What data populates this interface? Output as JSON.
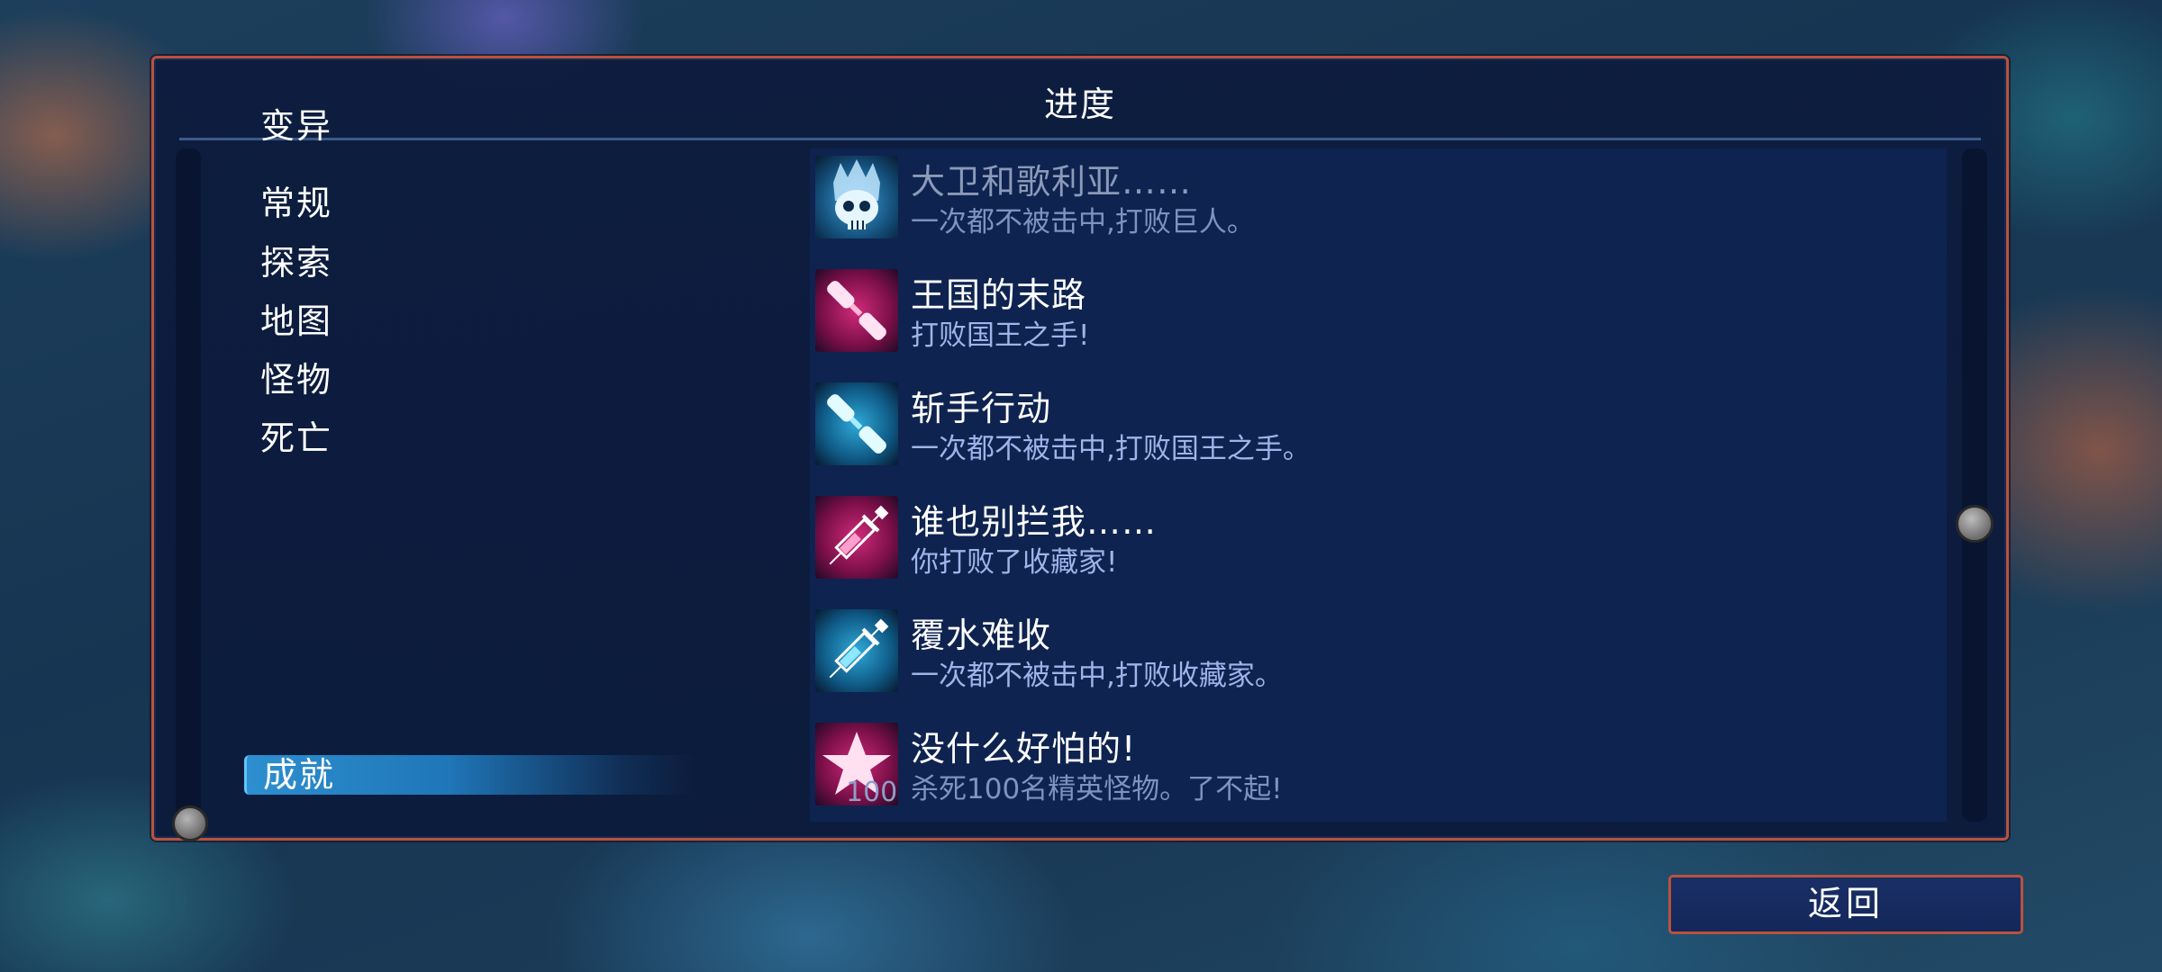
{
  "title": "进度",
  "categories": [
    {
      "label": "变异"
    },
    {
      "label": "常规"
    },
    {
      "label": "探索"
    },
    {
      "label": "地图"
    },
    {
      "label": "怪物"
    },
    {
      "label": "死亡"
    },
    {
      "label": "成就",
      "active": true
    }
  ],
  "achievements": [
    {
      "title": "大卫和歌利亚……",
      "desc": "一次都不被击中,打败巨人。",
      "icon": "skull-crown-icon",
      "locked": true
    },
    {
      "title": "王国的末路",
      "desc": "打败国王之手!",
      "icon": "pink-blade-icon"
    },
    {
      "title": "斩手行动",
      "desc": "一次都不被击中,打败国王之手。",
      "icon": "cyan-blade-icon"
    },
    {
      "title": "谁也别拦我……",
      "desc": "你打败了收藏家!",
      "icon": "pink-syringe-icon"
    },
    {
      "title": "覆水难收",
      "desc": "一次都不被击中,打败收藏家。",
      "icon": "cyan-syringe-icon"
    },
    {
      "title": "没什么好怕的!",
      "desc": "杀死100名精英怪物。了不起!",
      "icon": "pink-star-icon",
      "count": "100"
    }
  ],
  "back_button": "返回",
  "colors": {
    "panel_border": "#b9523d",
    "active_tab": "#2d8fcf",
    "pink_icon": "#d02a7a",
    "cyan_icon": "#2fa9d8"
  }
}
